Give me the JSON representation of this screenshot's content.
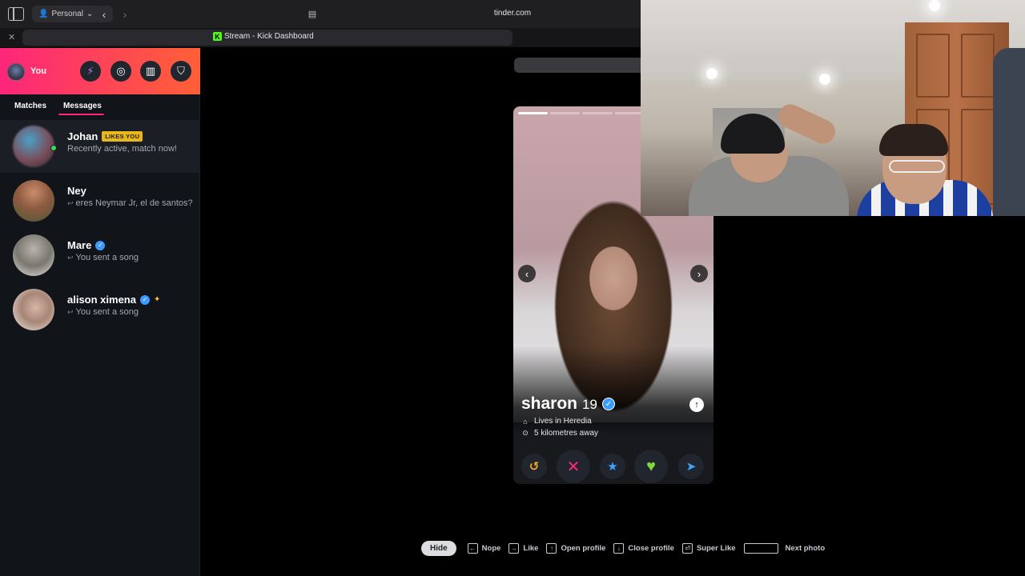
{
  "browser": {
    "profile_label": "Personal",
    "url": "tinder.com",
    "tab_title": "Stream - Kick Dashboard",
    "tab_favicon": "K"
  },
  "sidebar": {
    "me_label": "You",
    "header_icons": [
      "boost-icon",
      "explore-icon",
      "briefcase-icon",
      "shield-icon"
    ],
    "tabs": [
      {
        "label": "Matches"
      },
      {
        "label": "Messages"
      }
    ],
    "active_tab": "Messages",
    "conversations": [
      {
        "name": "Johan",
        "badge": "LIKES YOU",
        "message": "Recently active, match now!"
      },
      {
        "name": "Ney",
        "message": "eres Neymar Jr, el de santos?"
      },
      {
        "name": "Mare",
        "verified": true,
        "message": "You sent a song"
      },
      {
        "name": "alison ximena",
        "verified": true,
        "message": "You sent a song"
      }
    ]
  },
  "card": {
    "name": "sharon",
    "age": "19",
    "verified": true,
    "lives_in": "Lives in Heredia",
    "distance": "5 kilometres away",
    "photo_count": 6,
    "current_photo": 1,
    "actions": [
      {
        "name": "rewind",
        "glyph": "↺",
        "color": "#f5a623"
      },
      {
        "name": "nope",
        "glyph": "✕",
        "color": "#fd267a"
      },
      {
        "name": "super-like",
        "glyph": "★",
        "color": "#3ca4ff"
      },
      {
        "name": "like",
        "glyph": "♥",
        "color": "#7ed83a"
      },
      {
        "name": "boost",
        "glyph": "➤",
        "color": "#3ca4ff"
      }
    ]
  },
  "shortcuts": {
    "hide_label": "Hide",
    "items": [
      {
        "key": "←",
        "label": "Nope"
      },
      {
        "key": "→",
        "label": "Like"
      },
      {
        "key": "↑",
        "label": "Open profile"
      },
      {
        "key": "↓",
        "label": "Close profile"
      },
      {
        "key": "⏎",
        "label": "Super Like"
      },
      {
        "key": "",
        "label": "Next photo"
      }
    ]
  },
  "colors": {
    "brand_start": "#fd267a",
    "brand_end": "#ff6036",
    "likes_badge": "#e8b71b",
    "verified": "#3b9bff"
  }
}
